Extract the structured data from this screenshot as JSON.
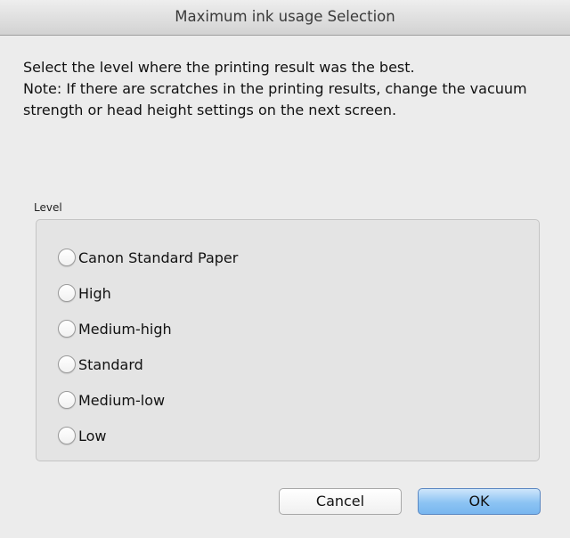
{
  "window": {
    "title": "Maximum ink usage Selection"
  },
  "instructions": {
    "line1": "Select the level where the printing result was the best.",
    "line2": "Note: If there are scratches in the printing results, change the vacuum strength or head height settings on the next screen."
  },
  "level_group": {
    "label": "Level",
    "options": [
      {
        "label": "Canon Standard Paper",
        "selected": false
      },
      {
        "label": "High",
        "selected": false
      },
      {
        "label": "Medium-high",
        "selected": false
      },
      {
        "label": "Standard",
        "selected": false
      },
      {
        "label": "Medium-low",
        "selected": false
      },
      {
        "label": "Low",
        "selected": false
      }
    ]
  },
  "buttons": {
    "cancel_label": "Cancel",
    "ok_label": "OK"
  },
  "colors": {
    "default_button": "#8cc3f3",
    "window_background": "#ececec"
  }
}
